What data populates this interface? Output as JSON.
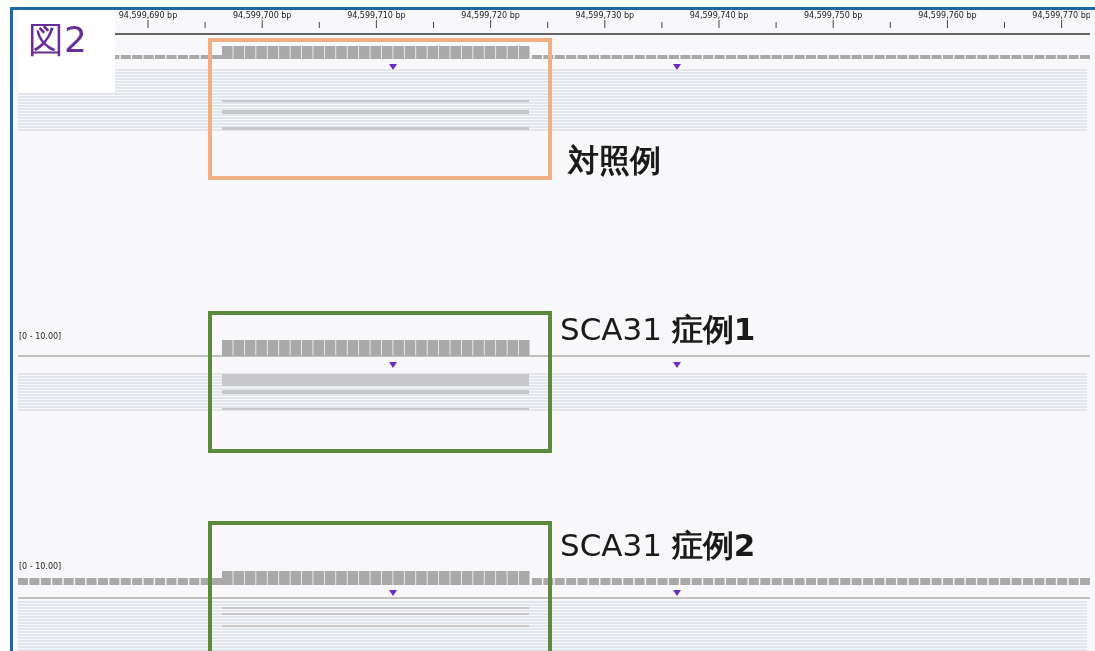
{
  "figure_label": "図2",
  "ruler": {
    "ticks": [
      "94,599,690 bp",
      "94,599,700 bp",
      "94,599,710 bp",
      "94,599,720 bp",
      "94,599,730 bp",
      "94,599,740 bp",
      "94,599,750 bp",
      "94,599,760 bp",
      "94,599,770 bp"
    ]
  },
  "samples": [
    {
      "flank_coverage": true,
      "annotation": {
        "label": "対照例",
        "color": "#f0b083"
      }
    },
    {
      "range_label": "[0 - 10.00]",
      "flank_coverage": false,
      "annotation": {
        "label": "SCA31 **症例1**",
        "color": "#5b8a3c"
      }
    },
    {
      "range_label": "[0 - 10.00]",
      "flank_coverage": true,
      "annotation": {
        "label": "SCA31 **症例2**",
        "color": "#5b8a3c"
      }
    }
  ]
}
